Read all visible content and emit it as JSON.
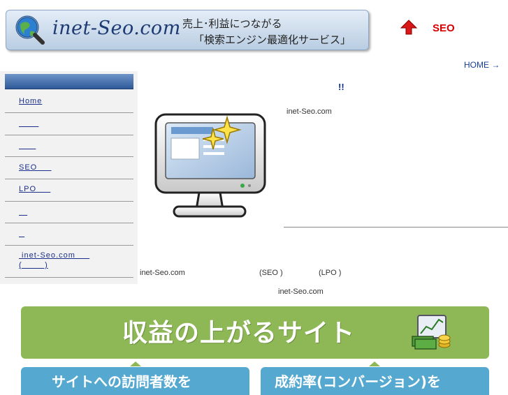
{
  "header": {
    "logo_text": "inet-Seo.com",
    "tagline_line1": "売上･利益につながる",
    "tagline_line2": "「検索エンジン最適化サービス」",
    "seo_label": "SEO"
  },
  "nav": {
    "home_link": "HOME →"
  },
  "sidebar": {
    "items": [
      {
        "label": "Home"
      },
      {
        "label": "       "
      },
      {
        "label": "      "
      },
      {
        "label": "SEO     "
      },
      {
        "label": "LPO     "
      },
      {
        "label": "   "
      },
      {
        "label": "  "
      },
      {
        "label": " inet-Seo.com     ",
        "label2": "(        )"
      }
    ]
  },
  "main": {
    "headline": "!!",
    "intro": "inet-Seo.com",
    "para_inet": "inet-Seo.com",
    "para_seo": "(SEO )",
    "para_lpo": "(LPO )",
    "para_inet2": "inet-Seo.com"
  },
  "green_banner": {
    "title": "収益の上がるサイト"
  },
  "boxes": [
    {
      "text": "サイトへの訪問者数を"
    },
    {
      "text": "成約率(コンバージョン)を"
    }
  ],
  "colors": {
    "seo_red": "#d60000",
    "link_blue": "#1a3d9a",
    "banner_green": "#8eb856",
    "box_blue": "#55a8cf"
  },
  "icons": [
    "globe-magnifier-icon",
    "red-up-arrow-icon",
    "monitor-sparkle-icon",
    "money-chart-icon"
  ]
}
